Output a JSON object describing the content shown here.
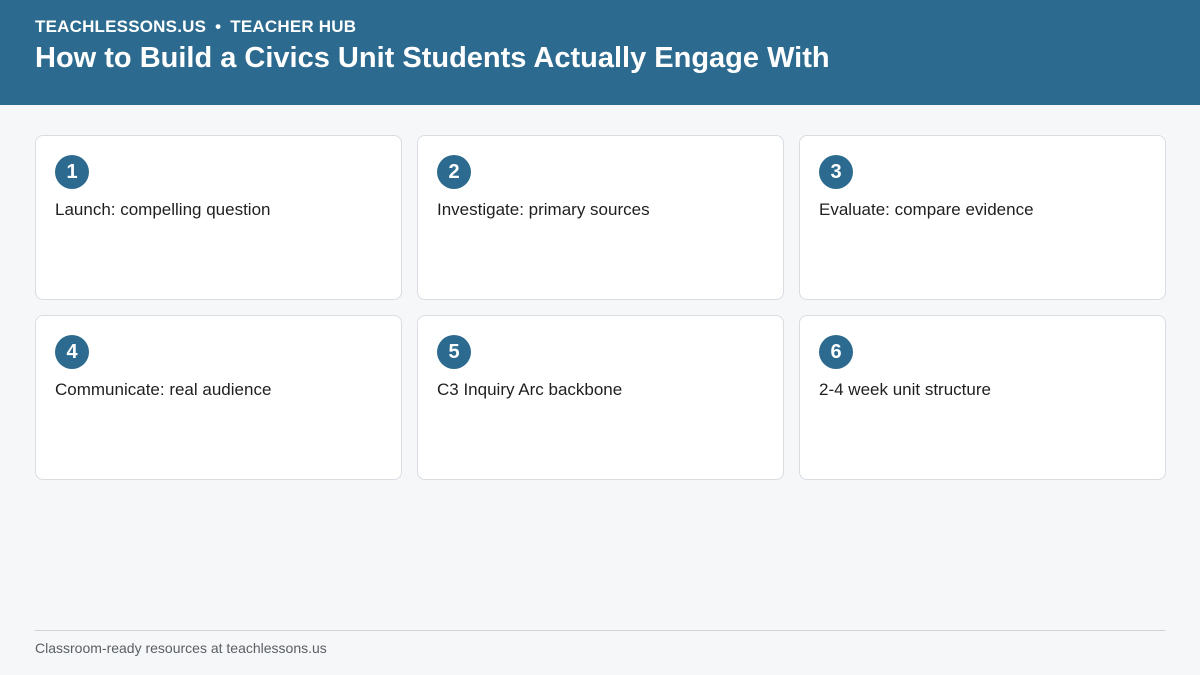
{
  "header": {
    "site": "TEACHLESSONS.US",
    "separator": "•",
    "section": "TEACHER HUB",
    "title": "How to Build a Civics Unit Students Actually Engage With"
  },
  "steps": [
    {
      "number": "1",
      "text": "Launch: compelling question"
    },
    {
      "number": "2",
      "text": "Investigate: primary sources"
    },
    {
      "number": "3",
      "text": "Evaluate: compare evidence"
    },
    {
      "number": "4",
      "text": "Communicate: real audience"
    },
    {
      "number": "5",
      "text": "C3 Inquiry Arc backbone"
    },
    {
      "number": "6",
      "text": "2-4 week unit structure"
    }
  ],
  "footer": {
    "text": "Classroom-ready resources at teachlessons.us"
  },
  "colors": {
    "header_bg": "#2c6b8f",
    "page_bg": "#f5f7f9",
    "badge_bg": "#2c6b8f"
  }
}
